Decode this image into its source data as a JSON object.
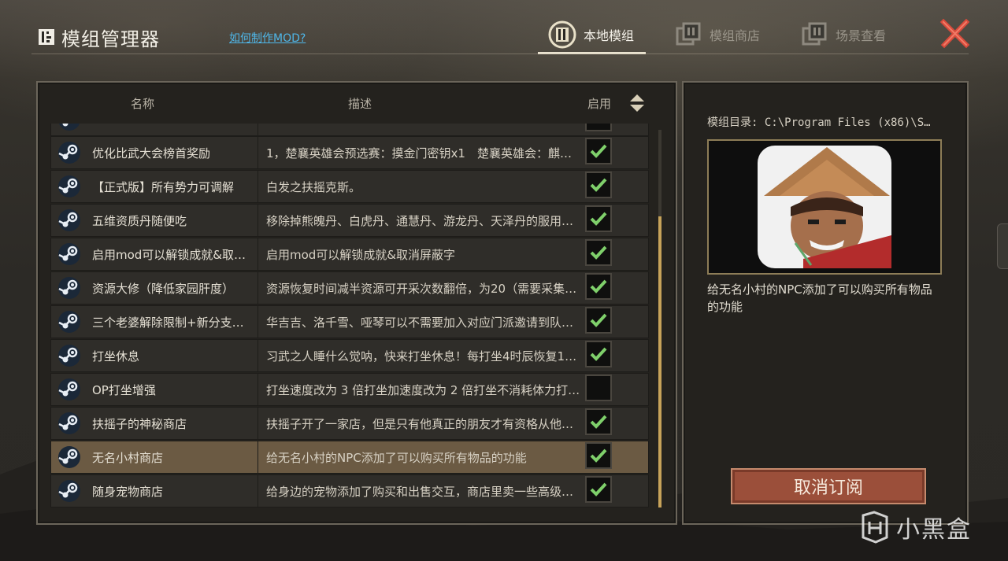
{
  "header": {
    "title": "模组管理器",
    "how_to_link": "如何制作MOD?",
    "tabs": [
      {
        "label": "本地模组",
        "active": true,
        "icon": "local-mod-icon"
      },
      {
        "label": "模组商店",
        "active": false,
        "icon": "mod-store-icon"
      },
      {
        "label": "场景查看",
        "active": false,
        "icon": "scene-view-icon"
      }
    ],
    "close_icon": "close-icon"
  },
  "list": {
    "columns": {
      "name": "名称",
      "desc": "描述",
      "enabled": "启用"
    },
    "rows": [
      {
        "name": "",
        "desc": "",
        "enabled": false
      },
      {
        "name": "优化比武大会榜首奖励",
        "desc": "1，楚襄英雄会预选赛：摸金门密钥x1　楚襄英雄会：麒…",
        "enabled": true
      },
      {
        "name": "【正式版】所有势力可调解",
        "desc": "白发之扶摇克斯。",
        "enabled": true
      },
      {
        "name": "五维资质丹随便吃",
        "desc": "移除掉熊魄丹、白虎丹、通慧丹、游龙丹、天泽丹的服用…",
        "enabled": true
      },
      {
        "name": "启用mod可以解锁成就&取…",
        "desc": "启用mod可以解锁成就&取消屏蔽字",
        "enabled": true
      },
      {
        "name": "资源大修（降低家园肝度）",
        "desc": "资源恢复时间减半资源可开采次数翻倍，为20（需要采集…",
        "enabled": true
      },
      {
        "name": "三个老婆解除限制+新分支…",
        "desc": "华吉吉、洛千雪、哑琴可以不需要加入对应门派邀请到队…",
        "enabled": true
      },
      {
        "name": "打坐休息",
        "desc": "习武之人睡什么觉呐，快来打坐休息！每打坐4时辰恢复1…",
        "enabled": true
      },
      {
        "name": "OP打坐增强",
        "desc": "打坐速度改为 3 倍打坐加速度改为 2 倍打坐不消耗体力打…",
        "enabled": false
      },
      {
        "name": "扶摇子的神秘商店",
        "desc": "扶摇子开了一家店，但是只有他真正的朋友才有资格从他…",
        "enabled": true
      },
      {
        "name": "无名小村商店",
        "desc": "给无名小村的NPC添加了可以购买所有物品的功能",
        "enabled": true,
        "selected": true
      },
      {
        "name": "随身宠物商店",
        "desc": "给身边的宠物添加了购买和出售交互，商店里卖一些高级…",
        "enabled": true
      }
    ]
  },
  "detail": {
    "directory": "模组目录: C:\\Program Files (x86)\\S…",
    "description": "给无名小村的NPC添加了可以购买所有物品的功能",
    "unsubscribe_label": "取消订阅"
  },
  "watermark": "小黑盒",
  "colors": {
    "accent_link": "#4fb6e8",
    "checkbox_check": "#7fd06b",
    "selected_row": "#6b5a43",
    "unsubscribe_btn": "#9b4f3a"
  }
}
